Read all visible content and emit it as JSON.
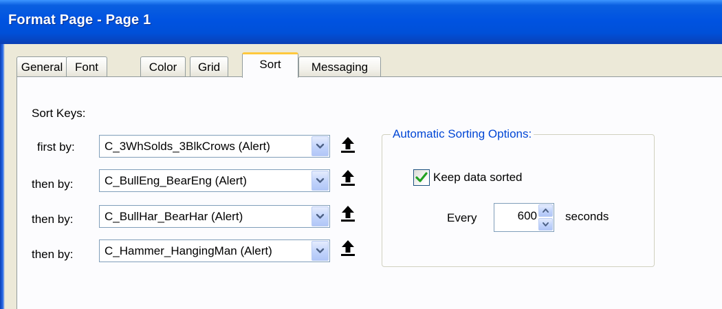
{
  "window": {
    "title": "Format Page - Page 1"
  },
  "tabs": [
    {
      "label": "General"
    },
    {
      "label": "Font"
    },
    {
      "label": "Color"
    },
    {
      "label": "Grid"
    },
    {
      "label": "Sort",
      "active": true
    },
    {
      "label": "Messaging"
    }
  ],
  "sort_keys": {
    "heading": "Sort Keys:",
    "rows": [
      {
        "label": "first by:",
        "value": "C_3WhSolds_3BlkCrows (Alert)"
      },
      {
        "label": "then by:",
        "value": "C_BullEng_BearEng (Alert)"
      },
      {
        "label": "then by:",
        "value": "C_BullHar_BearHar (Alert)"
      },
      {
        "label": "then by:",
        "value": "C_Hammer_HangingMan (Alert)"
      }
    ]
  },
  "auto_sort": {
    "title": "Automatic Sorting Options:",
    "keep_sorted_label": "Keep data sorted",
    "keep_sorted_checked": true,
    "every_label": "Every",
    "interval_value": "600",
    "seconds_label": "seconds"
  },
  "colors": {
    "title_bar": "#0053e1",
    "group_title": "#0046d5",
    "active_tab_highlight": "#ffc83c",
    "check_mark": "#21a121"
  },
  "icons": {
    "combo_dropdown": "chevron-down-icon",
    "move_up": "arrow-up-icon",
    "spin_up": "spin-up-icon",
    "spin_down": "spin-down-icon"
  }
}
